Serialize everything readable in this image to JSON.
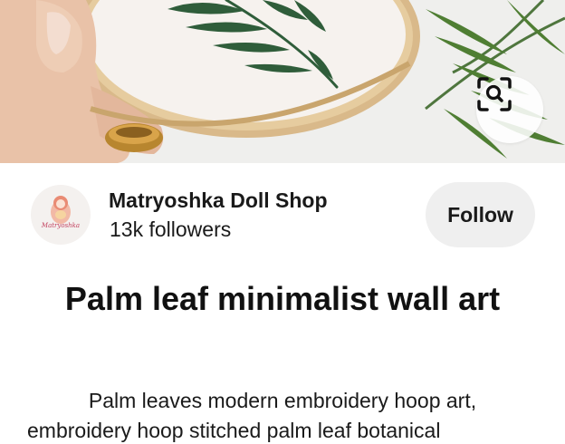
{
  "pin": {
    "title": "Palm leaf minimalist wall art",
    "description": "Palm leaves modern embroidery hoop art,",
    "description_cont": "embroidery hoop stitched palm leaf botanical"
  },
  "creator": {
    "name": "Matryoshka Doll Shop",
    "followers": "13k followers",
    "avatar_text": "Matryoshka"
  },
  "actions": {
    "follow_label": "Follow",
    "visual_search_icon": "lens-search-icon"
  },
  "colors": {
    "follow_bg": "#efefef",
    "leaf_green": "#2f5d3a",
    "hoop_wood": "#d9b98a"
  }
}
